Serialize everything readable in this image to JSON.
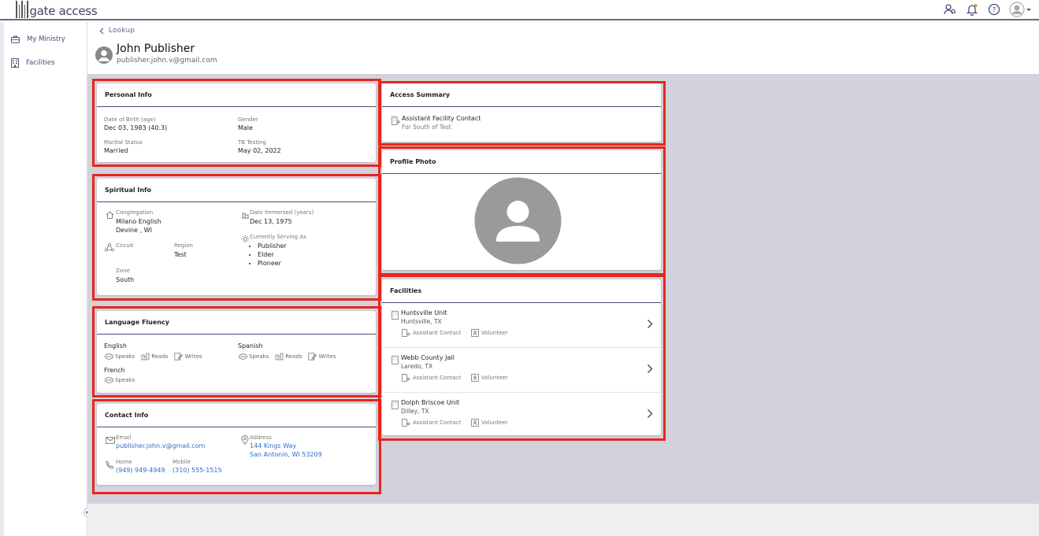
{
  "app": {
    "logo_text": "gate access"
  },
  "sidebar": {
    "items": [
      {
        "label": "My Ministry",
        "icon": "briefcase-icon"
      },
      {
        "label": "Facilities",
        "icon": "building-icon"
      }
    ]
  },
  "header": {
    "back_label": "Lookup",
    "name": "John Publisher",
    "email": "publisher.john.v@gmail.com"
  },
  "personal_info": {
    "title": "Personal Info",
    "dob_label": "Date of Birth (age)",
    "dob_value": "Dec 03, 1983 (40.3)",
    "gender_label": "Gender",
    "gender_value": "Male",
    "marital_label": "Marital Status",
    "marital_value": "Married",
    "tb_label": "TB Testing",
    "tb_value": "May 02, 2022"
  },
  "spiritual_info": {
    "title": "Spiritual Info",
    "congregation_label": "Congregation",
    "congregation_value": "Milano English",
    "congregation_location": "Devine , WI",
    "immersed_label": "Date Immersed (years)",
    "immersed_value": "Dec 13, 1975",
    "serving_label": "Currently Serving As",
    "serving": [
      "Publisher",
      "Elder",
      "Pioneer"
    ],
    "circuit_label": "Circuit",
    "region_label": "Region",
    "region_value": "Test",
    "zone_label": "Zone",
    "zone_value": "South"
  },
  "language_fluency": {
    "title": "Language Fluency",
    "languages": [
      {
        "name": "English",
        "skills": [
          "Speaks",
          "Reads",
          "Writes"
        ]
      },
      {
        "name": "Spanish",
        "skills": [
          "Speaks",
          "Reads",
          "Writes"
        ]
      },
      {
        "name": "French",
        "skills": [
          "Speaks"
        ]
      }
    ]
  },
  "contact_info": {
    "title": "Contact Info",
    "email_label": "Email",
    "email_value": "publisher.john.v@gmail.com",
    "address_label": "Address",
    "address_line1": "144 Kings Way",
    "address_line2": "San Antonio, WI 53209",
    "home_label": "Home",
    "home_value": "(949) 949-4949",
    "mobile_label": "Mobile",
    "mobile_value": "(310) 555-1515"
  },
  "access_summary": {
    "title": "Access Summary",
    "role": "Assistant Facility Contact",
    "scope": "For South of Test"
  },
  "profile_photo": {
    "title": "Profile Photo"
  },
  "facilities": {
    "title": "Facilities",
    "items": [
      {
        "name": "Huntsville Unit",
        "location": "Huntsville, TX",
        "role1": "Assistant Contact",
        "role2": "Volunteer"
      },
      {
        "name": "Webb County Jail",
        "location": "Laredo, TX",
        "role1": "Assistant Contact",
        "role2": "Volunteer"
      },
      {
        "name": "Dolph Briscoe Unit",
        "location": "Dilley, TX",
        "role1": "Assistant Contact",
        "role2": "Volunteer"
      }
    ]
  },
  "colors": {
    "highlight": "#e8261c",
    "accent": "#4a4a7a",
    "link": "#2a6fc9",
    "content_bg": "#d2d2dc"
  }
}
